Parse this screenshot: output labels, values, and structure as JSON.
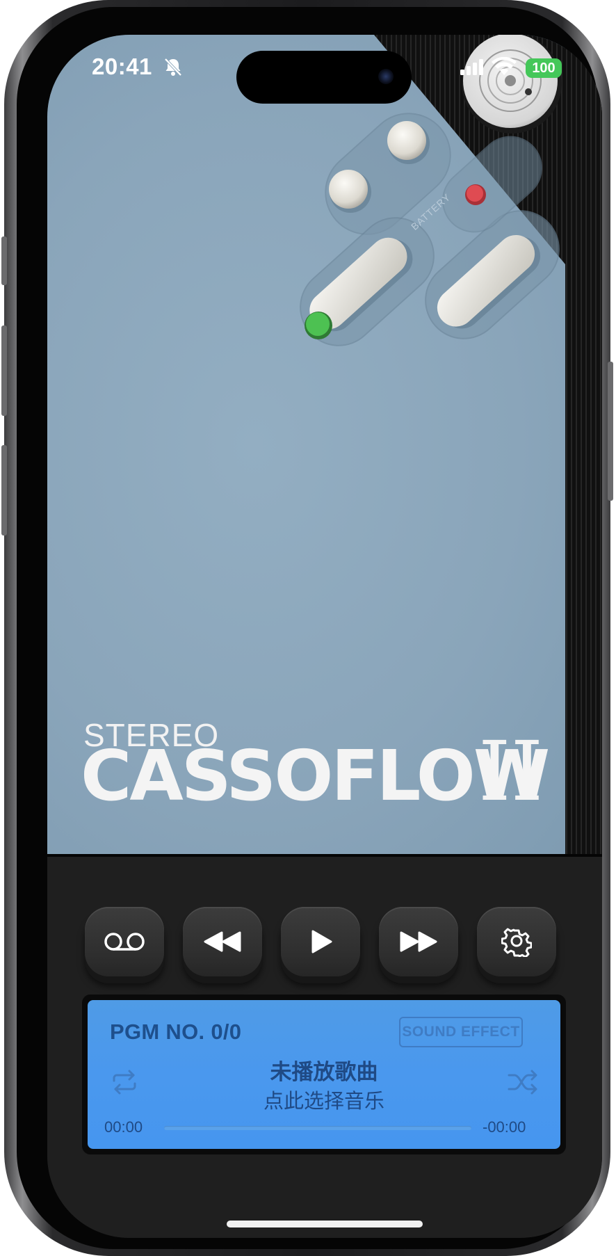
{
  "status_bar": {
    "time": "20:41",
    "battery": "100",
    "icons": [
      "bell-slash-icon",
      "signal-icon",
      "wifi-icon"
    ]
  },
  "device": {
    "battery_label": "BATTERY",
    "brand_small": "STEREO",
    "brand_logo": "CASSOFLOW",
    "brand_numeral": "II"
  },
  "controls": [
    {
      "name": "cassette-button",
      "icon": "voicemail-icon"
    },
    {
      "name": "rewind-button",
      "icon": "rewind-icon"
    },
    {
      "name": "play-button",
      "icon": "play-icon"
    },
    {
      "name": "fast-forward-button",
      "icon": "fast-forward-icon"
    },
    {
      "name": "settings-button",
      "icon": "gear-icon"
    }
  ],
  "lcd": {
    "pgm": "PGM NO. 0/0",
    "sound_effect": "SOUND EFFECT",
    "song_title": "未播放歌曲",
    "hint": "点此选择音乐",
    "elapsed": "00:00",
    "remaining": "-00:00",
    "progress": 0
  },
  "colors": {
    "panel": "#8ba7bc",
    "lcd": "#4a98ee",
    "lcd_text": "#1f4a85",
    "led_green": "#3fb545",
    "led_red": "#d93c43"
  }
}
